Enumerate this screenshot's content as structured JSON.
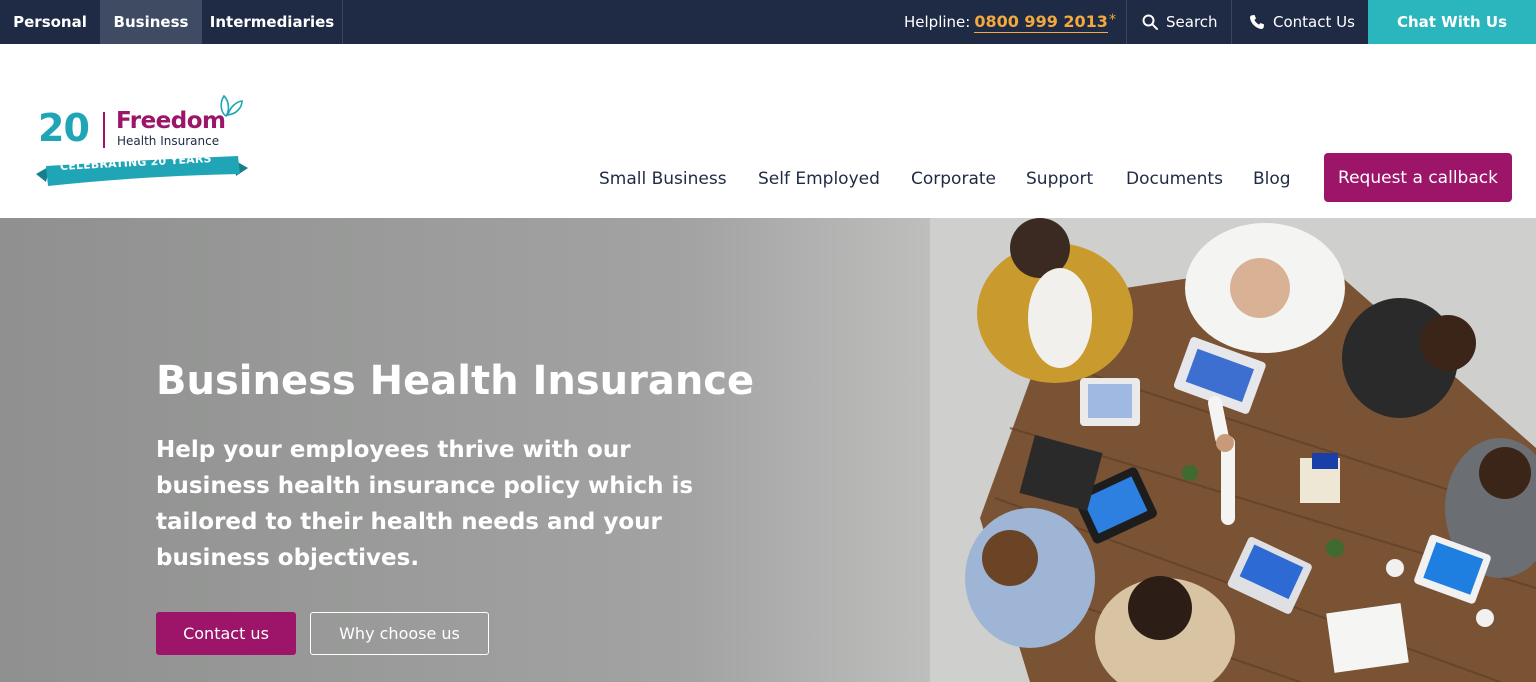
{
  "topbar": {
    "segments": [
      {
        "label": "Personal"
      },
      {
        "label": "Business",
        "active": true
      },
      {
        "label": "Intermediaries"
      }
    ],
    "helpline_label": "Helpline:",
    "helpline_number": "0800 999 2013",
    "helpline_asterisk": "*",
    "search_label": "Search",
    "search_icon": "search-icon",
    "contact_label": "Contact Us",
    "contact_icon": "phone-icon",
    "chat_label": "Chat With Us",
    "colors": {
      "bar": "#1f2a44",
      "active": "#3f4b63",
      "helpline": "#f3a93d",
      "chat": "#2bb6bd"
    }
  },
  "logo": {
    "number": "20",
    "brand": "Freedom",
    "subbrand": "Health Insurance",
    "ribbon": "CELEBRATING 20 YEARS",
    "colors": {
      "brand": "#9c1569",
      "teal": "#1fa5b5"
    }
  },
  "nav": {
    "items": [
      {
        "label": "Small Business"
      },
      {
        "label": "Self Employed"
      },
      {
        "label": "Corporate"
      },
      {
        "label": "Support"
      },
      {
        "label": "Documents"
      },
      {
        "label": "Blog"
      }
    ],
    "cta_label": "Request a callback",
    "cta_color": "#9c1569"
  },
  "hero": {
    "title": "Business Health Insurance",
    "subtitle": "Help your employees thrive with our business health insurance policy which is tailored to their health needs and your business objectives.",
    "primary_button": "Contact us",
    "secondary_button": "Why choose us"
  }
}
